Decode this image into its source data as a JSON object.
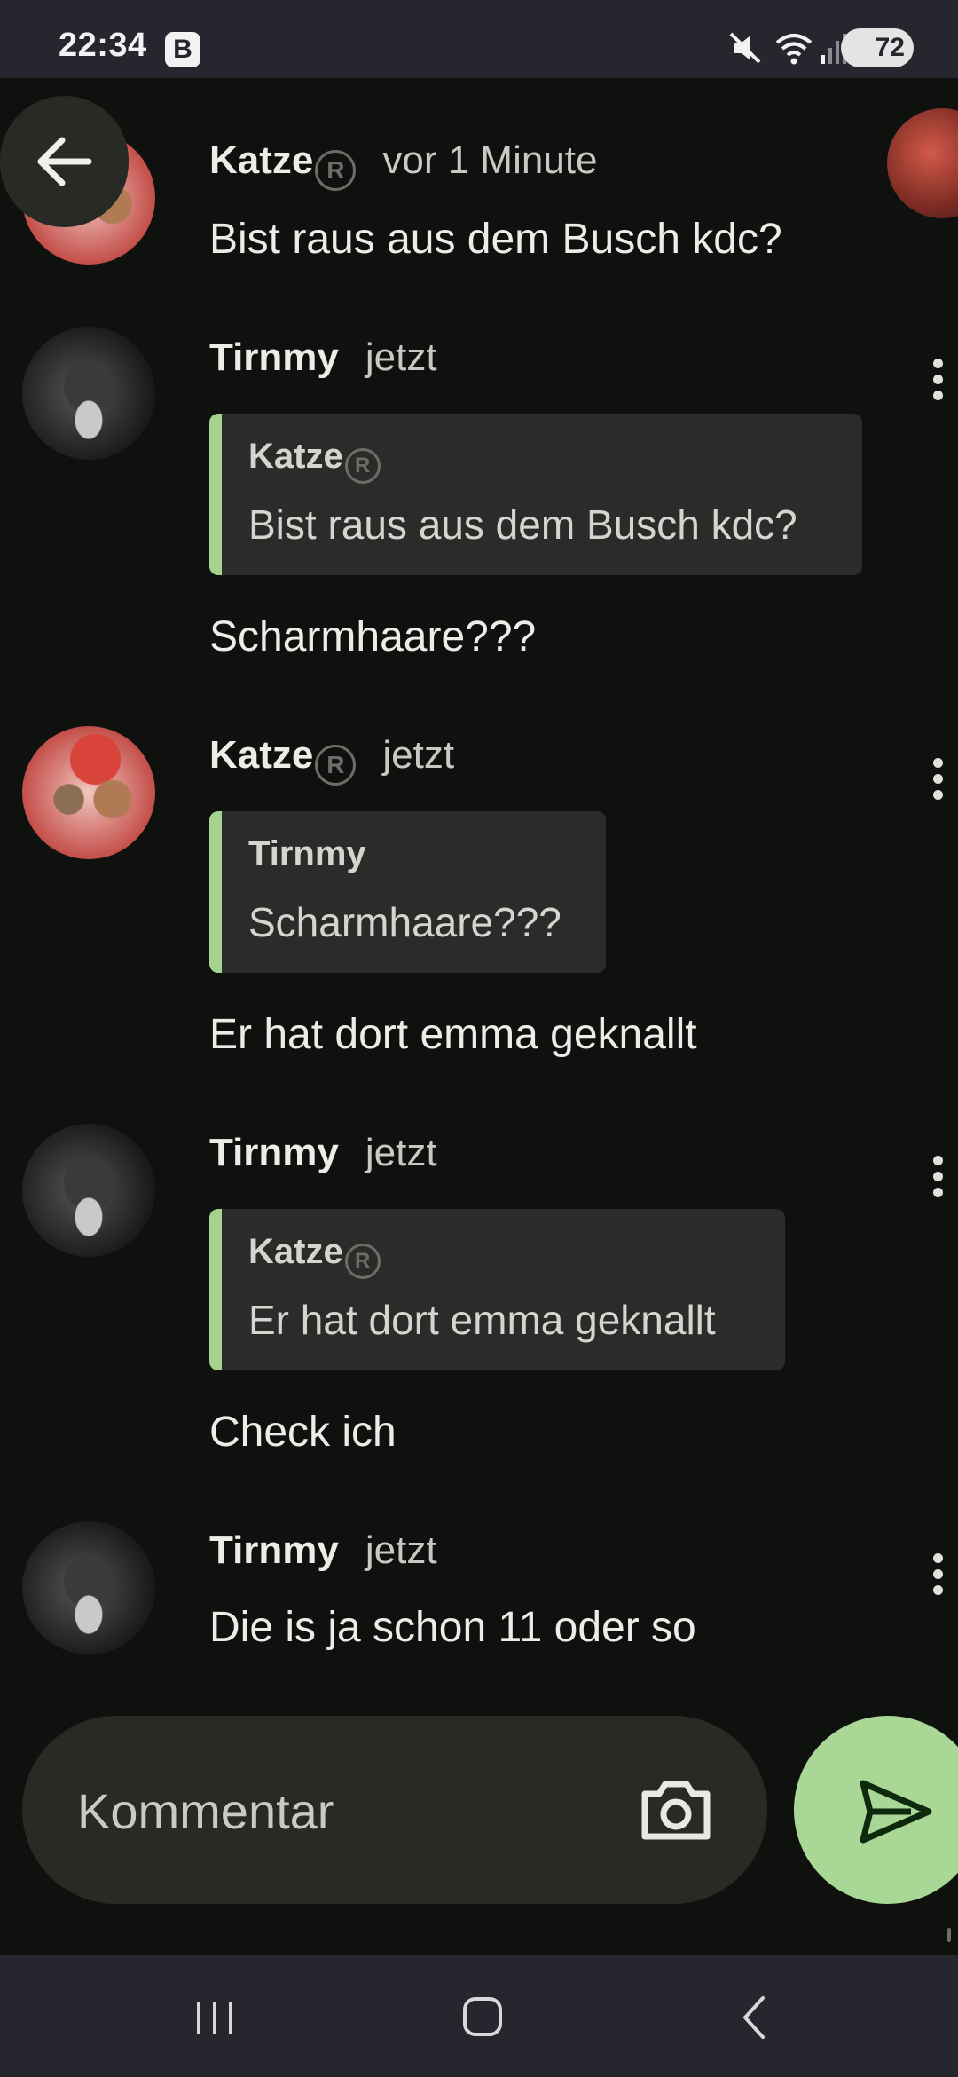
{
  "status_bar": {
    "time": "22:34",
    "badge": "B",
    "battery": "72"
  },
  "thread": {
    "top_message": {
      "author": "Katze",
      "time": "vor 1 Minute",
      "text": "Bist raus aus dem Busch kdc?"
    },
    "messages": [
      {
        "author": "Tirnmy",
        "time": "jetzt",
        "quote_author": "Katze",
        "quote_text": "Bist raus aus dem Busch kdc?",
        "text": "Scharmhaare???"
      },
      {
        "author": "Katze",
        "time": "jetzt",
        "quote_author": "Tirnmy",
        "quote_text": "Scharmhaare???",
        "text": "Er hat dort emma geknallt"
      },
      {
        "author": "Tirnmy",
        "time": "jetzt",
        "quote_author": "Katze",
        "quote_text": "Er hat dort emma geknallt",
        "text": "Check ich"
      },
      {
        "author": "Tirnmy",
        "time": "jetzt",
        "text": "Die is ja schon 11 oder so"
      }
    ]
  },
  "composer": {
    "placeholder": "Kommentar"
  },
  "icons": {
    "back": "arrow-left-icon",
    "camera": "camera-icon",
    "send": "send-icon",
    "more": "more-vertical-icon",
    "registered": "registered-icon",
    "nav_recents": "recents-icon",
    "nav_home": "home-icon",
    "nav_back": "chevron-left-icon"
  },
  "colors": {
    "background": "#0f110e",
    "accent": "#a8d796",
    "bubble": "#2b2c29",
    "system_bars": "#25262e"
  }
}
